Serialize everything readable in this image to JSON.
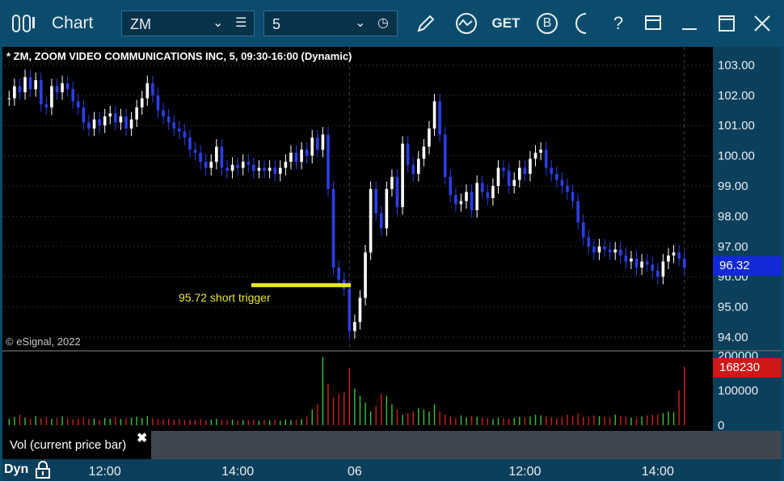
{
  "window": {
    "title": "Chart",
    "symbol": "ZM",
    "interval": "5",
    "icons": [
      "menu-lines-icon",
      "clock-icon",
      "pencil-icon",
      "study-icon",
      "get-icon",
      "b-icon",
      "t-icon",
      "help-icon",
      "layout-icon",
      "minimize-icon",
      "maximize-icon",
      "close-icon"
    ],
    "get_label": "GET",
    "b_label": "B",
    "help_label": "?"
  },
  "chart": {
    "header": "* ZM, ZOOM VIDEO COMMUNICATIONS INC, 5, 09:30-16:00 (Dynamic)",
    "copyright": "© eSignal, 2022",
    "trigger_label": "95.72 short trigger",
    "last_price": "96.32",
    "volume_value": "168230",
    "vol_panel_label": "Vol (current price bar)",
    "close_x": "✖",
    "dyn_label": "Dyn"
  },
  "chart_data": {
    "type": "candlestick",
    "price_ticks": [
      "103.00",
      "102.00",
      "101.00",
      "100.00",
      "99.00",
      "98.00",
      "97.00",
      "96.00",
      "95.00",
      "94.00"
    ],
    "volume_ticks": [
      "200000",
      "100000",
      "0"
    ],
    "time_ticks": [
      "12:00",
      "14:00",
      "06",
      "12:00",
      "14:00"
    ],
    "ylim": [
      93.6,
      103.6
    ],
    "volume_ylim": [
      0,
      200000
    ],
    "closes": [
      101.9,
      102.3,
      102.1,
      102.6,
      102.2,
      102.5,
      101.7,
      101.6,
      102.3,
      102.1,
      102.4,
      102.2,
      101.8,
      101.6,
      101.1,
      100.9,
      101.2,
      101.0,
      101.3,
      101.4,
      101.1,
      101.3,
      100.9,
      101.2,
      101.6,
      101.9,
      102.4,
      102.0,
      101.5,
      101.3,
      101.1,
      100.9,
      100.8,
      100.6,
      100.2,
      100.1,
      99.8,
      99.6,
      99.8,
      100.3,
      99.6,
      99.5,
      99.7,
      99.6,
      99.8,
      99.7,
      99.5,
      99.6,
      99.5,
      99.6,
      99.4,
      99.6,
      99.8,
      100.1,
      99.8,
      100.2,
      100.0,
      100.6,
      100.2,
      100.7,
      98.9,
      96.3,
      95.9,
      95.6,
      94.2,
      94.5,
      95.3,
      96.8,
      98.9,
      98.1,
      97.6,
      98.9,
      99.3,
      98.3,
      100.4,
      99.7,
      99.4,
      99.9,
      100.3,
      100.9,
      101.8,
      100.7,
      99.3,
      98.7,
      98.4,
      98.5,
      98.8,
      98.2,
      99.1,
      98.8,
      98.6,
      99.0,
      99.6,
      99.5,
      99.0,
      99.2,
      99.6,
      99.4,
      99.9,
      100.1,
      100.2,
      99.6,
      99.4,
      99.2,
      99.0,
      98.8,
      98.5,
      97.8,
      97.3,
      97.0,
      96.8,
      97.0,
      96.9,
      96.8,
      96.9,
      96.7,
      96.5,
      96.6,
      96.3,
      96.5,
      96.4,
      96.2,
      96.0,
      96.5,
      96.7,
      96.8,
      96.6,
      96.3
    ],
    "volumes": [
      18000,
      24000,
      30000,
      22000,
      19000,
      26000,
      20000,
      23000,
      18000,
      21000,
      25000,
      20000,
      17000,
      19000,
      22000,
      18000,
      20000,
      16000,
      21000,
      19000,
      23000,
      18000,
      20000,
      22000,
      25000,
      21000,
      26000,
      20000,
      18000,
      17000,
      19000,
      16000,
      18000,
      15000,
      17000,
      16000,
      18000,
      14000,
      16000,
      19000,
      15000,
      14000,
      16000,
      13000,
      15000,
      14000,
      16000,
      13000,
      15000,
      14000,
      16000,
      13000,
      17000,
      15000,
      16000,
      18000,
      25000,
      45000,
      60000,
      196000,
      120000,
      80000,
      90000,
      95000,
      165000,
      105000,
      85000,
      65000,
      40000,
      55000,
      90000,
      85000,
      60000,
      45000,
      30000,
      35000,
      40000,
      50000,
      45000,
      40000,
      60000,
      40000,
      30000,
      25000,
      20000,
      28000,
      22000,
      26000,
      24000,
      22000,
      20000,
      18000,
      22000,
      20000,
      19000,
      21000,
      24000,
      22000,
      25000,
      30000,
      28000,
      26000,
      22000,
      20000,
      24000,
      30000,
      28000,
      34000,
      24000,
      22000,
      28000,
      26000,
      24000,
      22000,
      30000,
      26000,
      24000,
      22000,
      20000,
      25000,
      28000,
      30000,
      32000,
      35000,
      40000,
      38000,
      100000,
      168230
    ],
    "trigger_level": 95.72
  }
}
